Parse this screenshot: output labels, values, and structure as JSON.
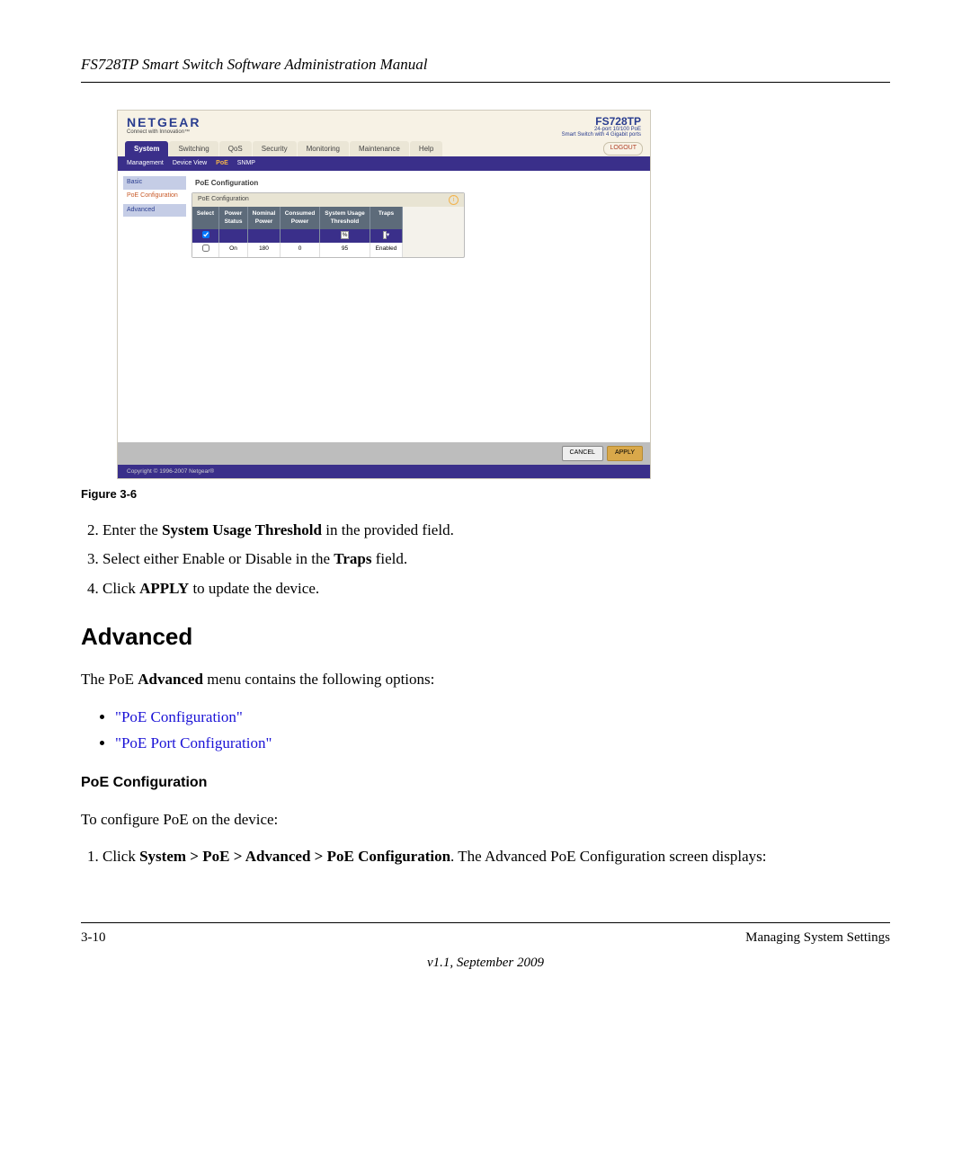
{
  "header": {
    "title": "FS728TP Smart Switch Software Administration Manual"
  },
  "screenshot": {
    "logo": "NETGEAR",
    "logo_tag": "Connect with Innovation™",
    "model": "FS728TP",
    "model_desc1": "24-port 10/100 PoE",
    "model_desc2": "Smart Switch with 4 Gigabit ports",
    "tabs": [
      "System",
      "Switching",
      "QoS",
      "Security",
      "Monitoring",
      "Maintenance",
      "Help"
    ],
    "logout": "LOGOUT",
    "subtabs": [
      "Management",
      "Device View",
      "PoE",
      "SNMP"
    ],
    "side": {
      "basic": "Basic",
      "poe": "PoE Configuration",
      "advanced": "Advanced"
    },
    "panel_title": "PoE Configuration",
    "panel_head": "PoE Configuration",
    "grid": {
      "h1": "Select",
      "h2": "Power Status",
      "h3": "Nominal Power",
      "h4": "Consumed Power",
      "h5": "System Usage Threshold",
      "h6": "Traps",
      "row1_threshold": "%",
      "row1_traps": "",
      "row2_power": "On",
      "row2_nominal": "180",
      "row2_consumed": "0",
      "row2_threshold": "95",
      "row2_traps": "Enabled"
    },
    "cancel": "CANCEL",
    "apply": "APPLY",
    "copyright": "Copyright © 1996-2007 Netgear®"
  },
  "fig_caption": "Figure 3-6",
  "steps": {
    "s2a": "Enter the ",
    "s2b": "System Usage Threshold",
    "s2c": " in the provided field.",
    "s3a": "Select either Enable or Disable in the ",
    "s3b": "Traps",
    "s3c": " field.",
    "s4a": "Click ",
    "s4b": "APPLY",
    "s4c": " to update the device."
  },
  "h2": "Advanced",
  "para1": "The PoE ",
  "para1b": "Advanced",
  "para1c": " menu contains the following options:",
  "links": {
    "l1": "\"PoE Configuration\"",
    "l2": "\"PoE Port Configuration\""
  },
  "h3": "PoE Configuration",
  "para2": "To configure PoE on the device:",
  "step1a": "Click ",
  "step1b": "System > PoE > Advanced > PoE Configuration",
  "step1c": ". The Advanced PoE Configuration screen displays:",
  "foot_left": "3-10",
  "foot_right": "Managing System Settings",
  "foot_center": "v1.1, September 2009"
}
